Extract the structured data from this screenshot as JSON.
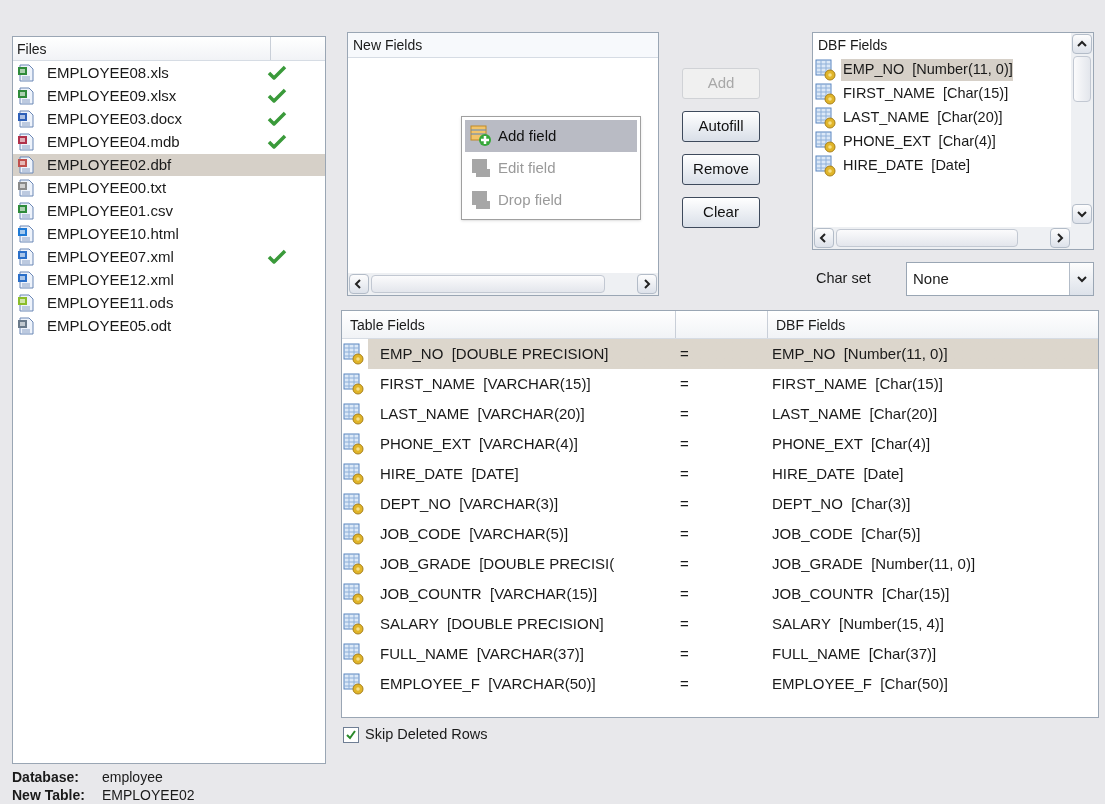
{
  "files": {
    "header": "Files",
    "items": [
      {
        "name": "EMPLOYEE08.xls",
        "kind": "sheet",
        "done": true,
        "selected": false
      },
      {
        "name": "EMPLOYEE09.xlsx",
        "kind": "sheet",
        "done": true,
        "selected": false
      },
      {
        "name": "EMPLOYEE03.docx",
        "kind": "word",
        "done": true,
        "selected": false
      },
      {
        "name": "EMPLOYEE04.mdb",
        "kind": "access",
        "done": true,
        "selected": false
      },
      {
        "name": "EMPLOYEE02.dbf",
        "kind": "dbf",
        "done": false,
        "selected": true
      },
      {
        "name": "EMPLOYEE00.txt",
        "kind": "text",
        "done": false,
        "selected": false
      },
      {
        "name": "EMPLOYEE01.csv",
        "kind": "csv",
        "done": false,
        "selected": false
      },
      {
        "name": "EMPLOYEE10.html",
        "kind": "web",
        "done": false,
        "selected": false
      },
      {
        "name": "EMPLOYEE07.xml",
        "kind": "xml",
        "done": true,
        "selected": false
      },
      {
        "name": "EMPLOYEE12.xml",
        "kind": "xml",
        "done": false,
        "selected": false
      },
      {
        "name": "EMPLOYEE11.ods",
        "kind": "calc",
        "done": false,
        "selected": false
      },
      {
        "name": "EMPLOYEE05.odt",
        "kind": "doc",
        "done": false,
        "selected": false
      }
    ]
  },
  "info": [
    {
      "label": "Database:",
      "value": "employee"
    },
    {
      "label": "New Table:",
      "value": "EMPLOYEE02"
    }
  ],
  "new_fields": {
    "header": "New Fields",
    "menu": [
      {
        "label": "Add field",
        "disabled": false,
        "selected": true
      },
      {
        "label": "Edit field",
        "disabled": true,
        "selected": false
      },
      {
        "label": "Drop field",
        "disabled": true,
        "selected": false
      }
    ]
  },
  "buttons": [
    {
      "label": "Add",
      "disabled": true
    },
    {
      "label": "Autofill",
      "disabled": false
    },
    {
      "label": "Remove",
      "disabled": false
    },
    {
      "label": "Clear",
      "disabled": false
    }
  ],
  "dbf_fields": {
    "header": "DBF Fields",
    "items": [
      {
        "label": "EMP_NO  [Number(11, 0)]",
        "selected": true
      },
      {
        "label": "FIRST_NAME  [Char(15)]",
        "selected": false
      },
      {
        "label": "LAST_NAME  [Char(20)]",
        "selected": false
      },
      {
        "label": "PHONE_EXT  [Char(4)]",
        "selected": false
      },
      {
        "label": "HIRE_DATE  [Date]",
        "selected": false
      }
    ]
  },
  "charset": {
    "label": "Char set",
    "value": "None"
  },
  "mapping": {
    "columns": [
      "Table Fields",
      "DBF Fields"
    ],
    "rows": [
      {
        "table_field": "EMP_NO  [DOUBLE PRECISION]",
        "op": "=",
        "dbf_field": "EMP_NO  [Number(11, 0)]",
        "selected": true
      },
      {
        "table_field": "FIRST_NAME  [VARCHAR(15)]",
        "op": "=",
        "dbf_field": "FIRST_NAME  [Char(15)]",
        "selected": false
      },
      {
        "table_field": "LAST_NAME  [VARCHAR(20)]",
        "op": "=",
        "dbf_field": "LAST_NAME  [Char(20)]",
        "selected": false
      },
      {
        "table_field": "PHONE_EXT  [VARCHAR(4)]",
        "op": "=",
        "dbf_field": "PHONE_EXT  [Char(4)]",
        "selected": false
      },
      {
        "table_field": "HIRE_DATE  [DATE]",
        "op": "=",
        "dbf_field": "HIRE_DATE  [Date]",
        "selected": false
      },
      {
        "table_field": "DEPT_NO  [VARCHAR(3)]",
        "op": "=",
        "dbf_field": "DEPT_NO  [Char(3)]",
        "selected": false
      },
      {
        "table_field": "JOB_CODE  [VARCHAR(5)]",
        "op": "=",
        "dbf_field": "JOB_CODE  [Char(5)]",
        "selected": false
      },
      {
        "table_field": "JOB_GRADE  [DOUBLE PRECISI(",
        "op": "=",
        "dbf_field": "JOB_GRADE  [Number(11, 0)]",
        "selected": false
      },
      {
        "table_field": "JOB_COUNTR  [VARCHAR(15)]",
        "op": "=",
        "dbf_field": "JOB_COUNTR  [Char(15)]",
        "selected": false
      },
      {
        "table_field": "SALARY  [DOUBLE PRECISION]",
        "op": "=",
        "dbf_field": "SALARY  [Number(15, 4)]",
        "selected": false
      },
      {
        "table_field": "FULL_NAME  [VARCHAR(37)]",
        "op": "=",
        "dbf_field": "FULL_NAME  [Char(37)]",
        "selected": false
      },
      {
        "table_field": "EMPLOYEE_F  [VARCHAR(50)]",
        "op": "=",
        "dbf_field": "EMPLOYEE_F  [Char(50)]",
        "selected": false
      }
    ]
  },
  "skip_deleted": {
    "label": "Skip Deleted Rows",
    "checked": true
  }
}
